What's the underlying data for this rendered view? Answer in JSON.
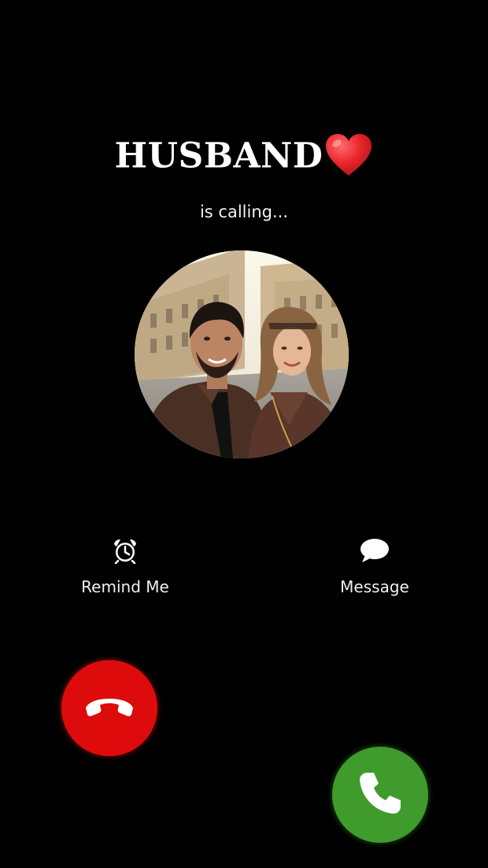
{
  "caller": {
    "name": "HUSBAND",
    "status": "is calling..."
  },
  "actions": {
    "remind": {
      "label": "Remind Me",
      "icon": "alarm-clock-icon"
    },
    "message": {
      "label": "Message",
      "icon": "speech-bubble-icon"
    }
  },
  "buttons": {
    "decline": {
      "icon": "phone-hangup-icon",
      "color": "#dd0b0b"
    },
    "accept": {
      "icon": "phone-icon",
      "color": "#3f9b2c"
    }
  },
  "colors": {
    "background": "#000000",
    "heart": "#e8262b"
  }
}
